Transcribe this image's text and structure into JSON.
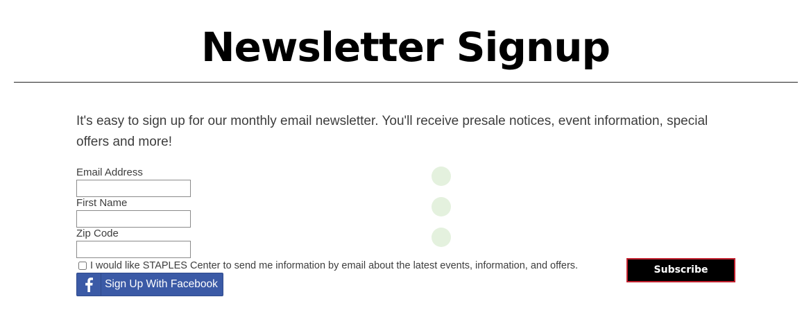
{
  "page": {
    "title": "Newsletter Signup",
    "intro": "It's easy to sign up for our monthly email newsletter. You'll receive presale notices, event information, special offers and more!"
  },
  "form": {
    "email_label": "Email Address",
    "email_value": "",
    "first_name_label": "First Name",
    "first_name_value": "",
    "zip_label": "Zip Code",
    "zip_value": "",
    "consent_text": "I would like STAPLES Center to send me information by email about the latest events, information, and offers.",
    "consent_checked": false,
    "subscribe_label": "Subscribe",
    "facebook_label": "Sign Up With Facebook"
  },
  "icons": {
    "facebook": "facebook-f-icon"
  },
  "colors": {
    "title": "#000000",
    "subscribe_bg": "#000000",
    "subscribe_border": "#c3202e",
    "facebook_bg": "#3b5aa6",
    "indicator_dot": "#e4f1de"
  }
}
